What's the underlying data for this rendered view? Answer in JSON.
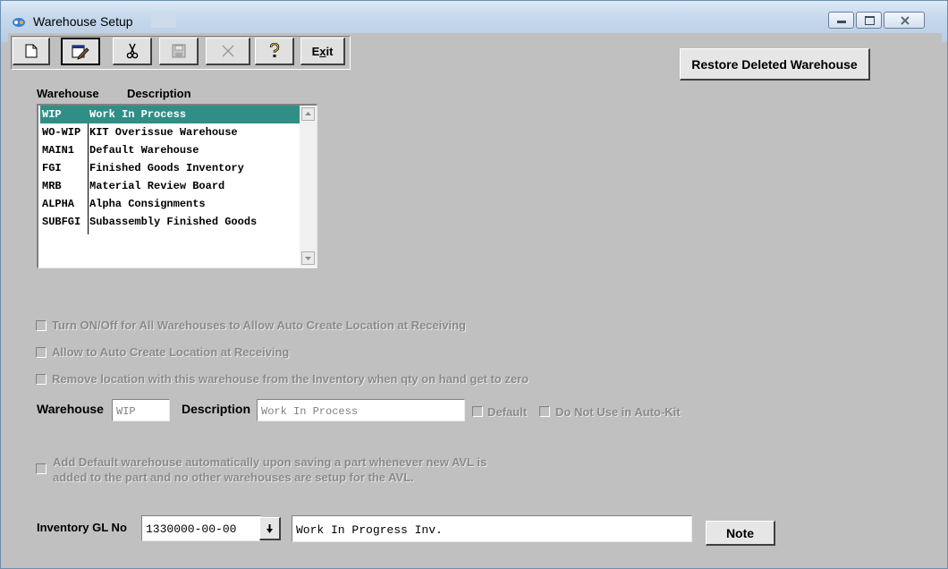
{
  "window": {
    "title": "Warehouse Setup"
  },
  "toolbar": {
    "exit_label": "Exit",
    "exit_hotkey": "x"
  },
  "restore_button_label": "Restore Deleted Warehouse",
  "list": {
    "header_warehouse": "Warehouse",
    "header_description": "Description",
    "rows": [
      {
        "code": "WIP",
        "description": "Work In Process",
        "selected": true
      },
      {
        "code": "WO-WIP",
        "description": "KIT Overissue Warehouse"
      },
      {
        "code": "MAIN1",
        "description": "Default Warehouse"
      },
      {
        "code": "FGI",
        "description": "Finished Goods Inventory"
      },
      {
        "code": "MRB",
        "description": "Material Review Board"
      },
      {
        "code": "ALPHA",
        "description": "Alpha Consignments"
      },
      {
        "code": "SUBFGI",
        "description": "Subassembly Finished Goods"
      }
    ]
  },
  "options": {
    "all_auto_create": "Turn ON/Off for All Warehouses to Allow Auto Create Location at Receiving",
    "auto_create": "Allow to Auto Create Location at Receiving",
    "remove_location": "Remove location with this warehouse from the Inventory when qty on hand get to zero"
  },
  "detail": {
    "warehouse_label": "Warehouse",
    "warehouse_value": "WIP",
    "description_label": "Description",
    "description_value": "Work In Process",
    "default_label": "Default",
    "not_autokit_label": "Do Not Use in Auto-Kit"
  },
  "add_default": {
    "line1": "Add Default warehouse automatically upon saving a part whenever new AVL is",
    "line2": "added to the part and no other warehouses are setup for the AVL."
  },
  "gl": {
    "label": "Inventory GL No",
    "number": "1330000-00-00",
    "description": "Work In Progress Inv.",
    "note_label": "Note"
  }
}
